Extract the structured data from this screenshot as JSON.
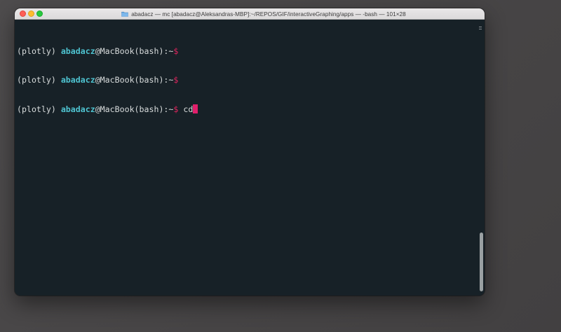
{
  "window": {
    "title": "abadacz — mc [abadacz@Aleksandras-MBP]:~/REPOS/GIF/interactiveGraphing/apps — -bash — 101×28",
    "title_icon": "folder-icon"
  },
  "controls": {
    "close": "close-button",
    "minimize": "minimize-button",
    "zoom": "zoom-button"
  },
  "colors": {
    "terminal_bg": "#172127",
    "text": "#d8dcdc",
    "username": "#4ec3d0",
    "prompt_symbol": "#e0245e",
    "cursor": "#e11f6b"
  },
  "terminal": {
    "lines": [
      {
        "env": "(plotly) ",
        "user": "abadacz",
        "host": "@MacBook(bash):",
        "path": "~",
        "symbol": "$",
        "command": ""
      },
      {
        "env": "(plotly) ",
        "user": "abadacz",
        "host": "@MacBook(bash):",
        "path": "~",
        "symbol": "$",
        "command": ""
      },
      {
        "env": "(plotly) ",
        "user": "abadacz",
        "host": "@MacBook(bash):",
        "path": "~",
        "symbol": "$",
        "command": " cd"
      }
    ]
  }
}
